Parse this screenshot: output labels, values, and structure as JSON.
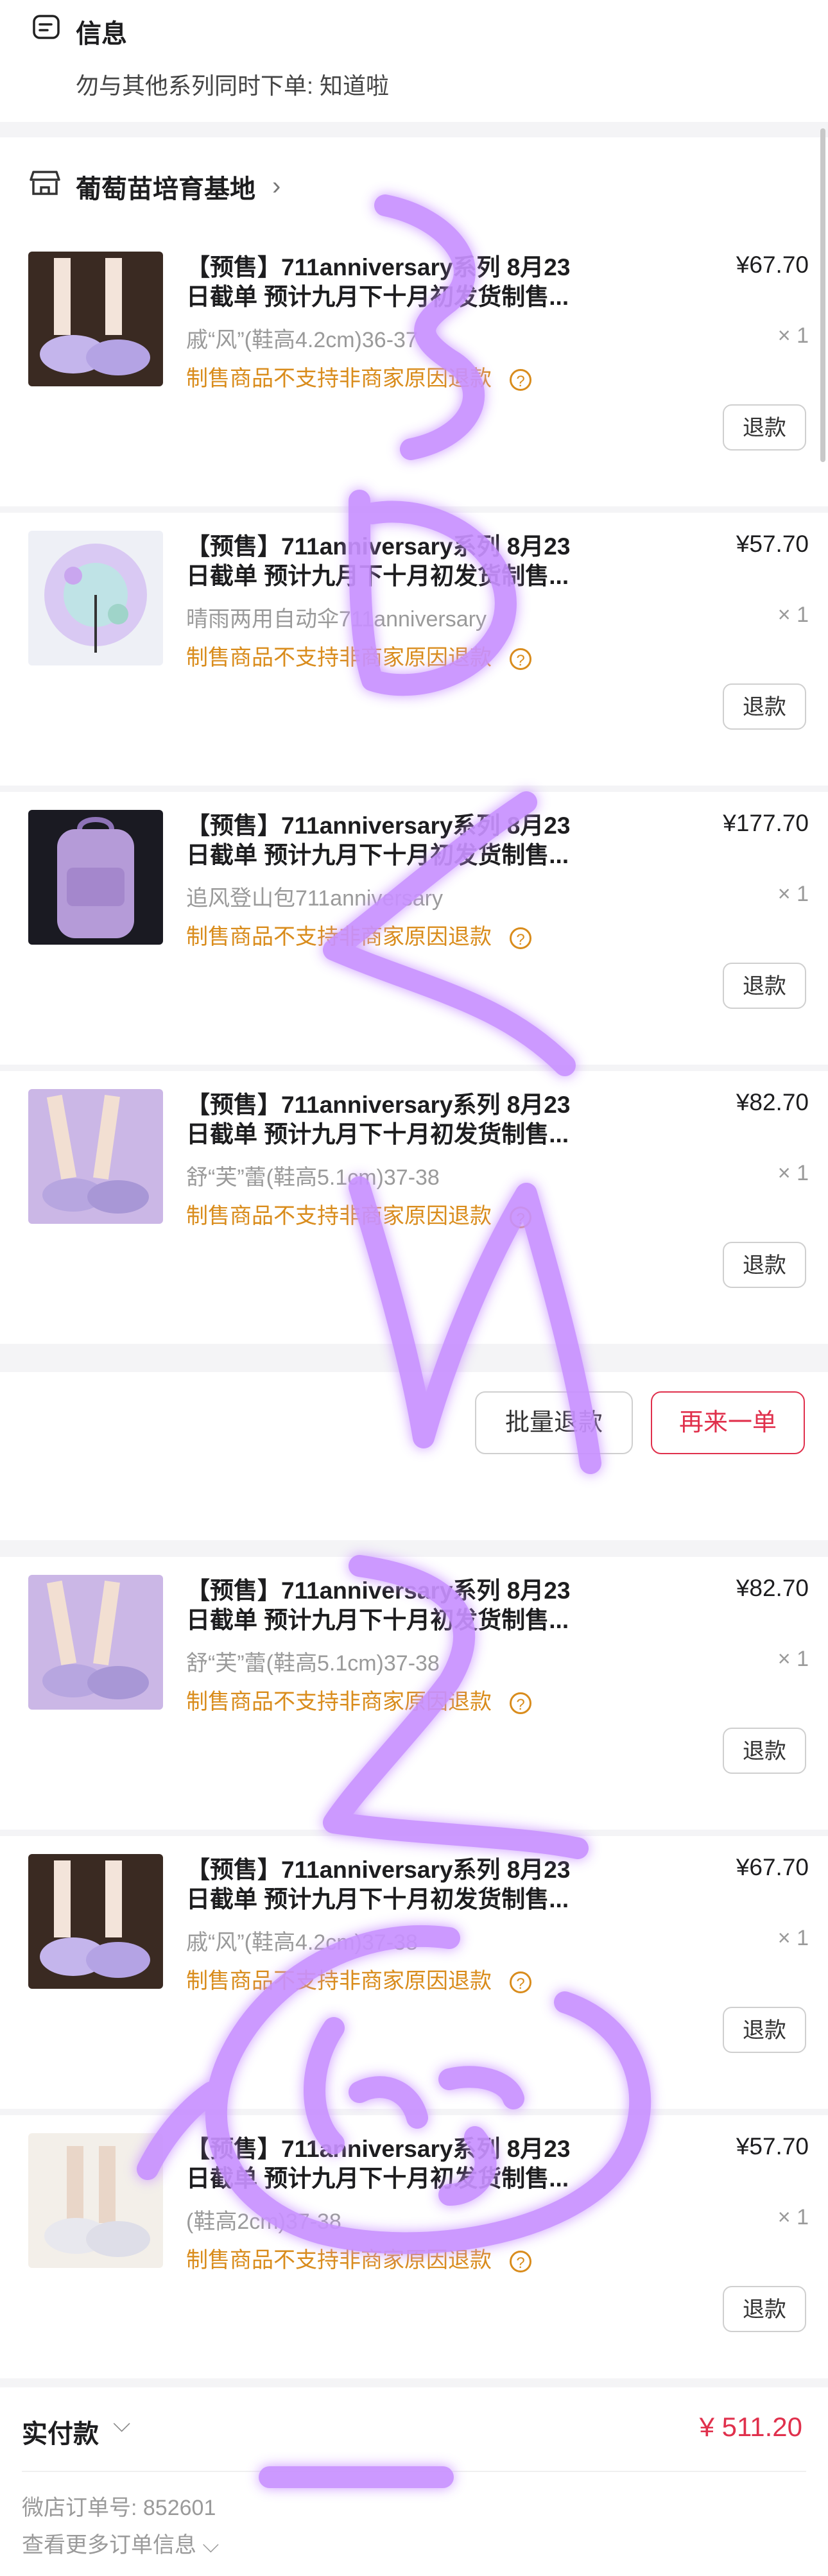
{
  "info": {
    "title": "信息",
    "message": "勿与其他系列同时下单: 知道啦"
  },
  "store": {
    "name": "葡萄苗培育基地"
  },
  "items": [
    {
      "title_line1": "【预售】711anniversary系列 8月23",
      "title_line2": "日截单 预计九月下十月初发货制售...",
      "price": "¥67.70",
      "variant": "戚“风”(鞋高4.2cm)36-37",
      "qty": "× 1",
      "notice": "制售商品不支持非商家原因退款",
      "refund_label": "退款",
      "thumb": "shoe-legs-dark"
    },
    {
      "title_line1": "【预售】711anniversary系列 8月23",
      "title_line2": "日截单 预计九月下十月初发货制售...",
      "price": "¥57.70",
      "variant": "晴雨两用自动伞711anniversary",
      "qty": "× 1",
      "notice": "制售商品不支持非商家原因退款",
      "refund_label": "退款",
      "thumb": "umbrella"
    },
    {
      "title_line1": "【预售】711anniversary系列 8月23",
      "title_line2": "日截单 预计九月下十月初发货制售...",
      "price": "¥177.70",
      "variant": "追风登山包711anniversary",
      "qty": "× 1",
      "notice": "制售商品不支持非商家原因退款",
      "refund_label": "退款",
      "thumb": "backpack"
    },
    {
      "title_line1": "【预售】711anniversary系列 8月23",
      "title_line2": "日截单 预计九月下十月初发货制售...",
      "price": "¥82.70",
      "variant": "舒“芙”蕾(鞋高5.1cm)37-38",
      "qty": "× 1",
      "notice": "制售商品不支持非商家原因退款",
      "refund_label": "退款",
      "thumb": "shoe-legs-lilac"
    },
    {
      "title_line1": "【预售】711anniversary系列 8月23",
      "title_line2": "日截单 预计九月下十月初发货制售...",
      "price": "¥82.70",
      "variant": "舒“芙”蕾(鞋高5.1cm)37-38",
      "qty": "× 1",
      "notice": "制售商品不支持非商家原因退款",
      "refund_label": "退款",
      "thumb": "shoe-legs-lilac"
    },
    {
      "title_line1": "【预售】711anniversary系列 8月23",
      "title_line2": "日截单 预计九月下十月初发货制售...",
      "price": "¥67.70",
      "variant": "戚“风”(鞋高4.2cm)37-38",
      "qty": "× 1",
      "notice": "制售商品不支持非商家原因退款",
      "refund_label": "退款",
      "thumb": "shoe-legs-dark"
    },
    {
      "title_line1": "【预售】711anniversary系列 8月23",
      "title_line2": "日截单 预计九月下十月初发货制售...",
      "price": "¥57.70",
      "variant": "(鞋高2cm)37-38",
      "qty": "× 1",
      "notice": "制售商品不支持非商家原因退款",
      "refund_label": "退款",
      "thumb": "shoe-white"
    }
  ],
  "actions": {
    "batch_refund": "批量退款",
    "buy_again": "再来一单"
  },
  "summary": {
    "total_label": "实付款",
    "total_amount": "¥ 511.20",
    "order_number": "微店订单号: 852601",
    "more_info": "查看更多订单信息"
  },
  "colors": {
    "accent_red": "#e0304c",
    "notice_orange": "#d98c1c",
    "scribble_purple": "#b56cff"
  }
}
